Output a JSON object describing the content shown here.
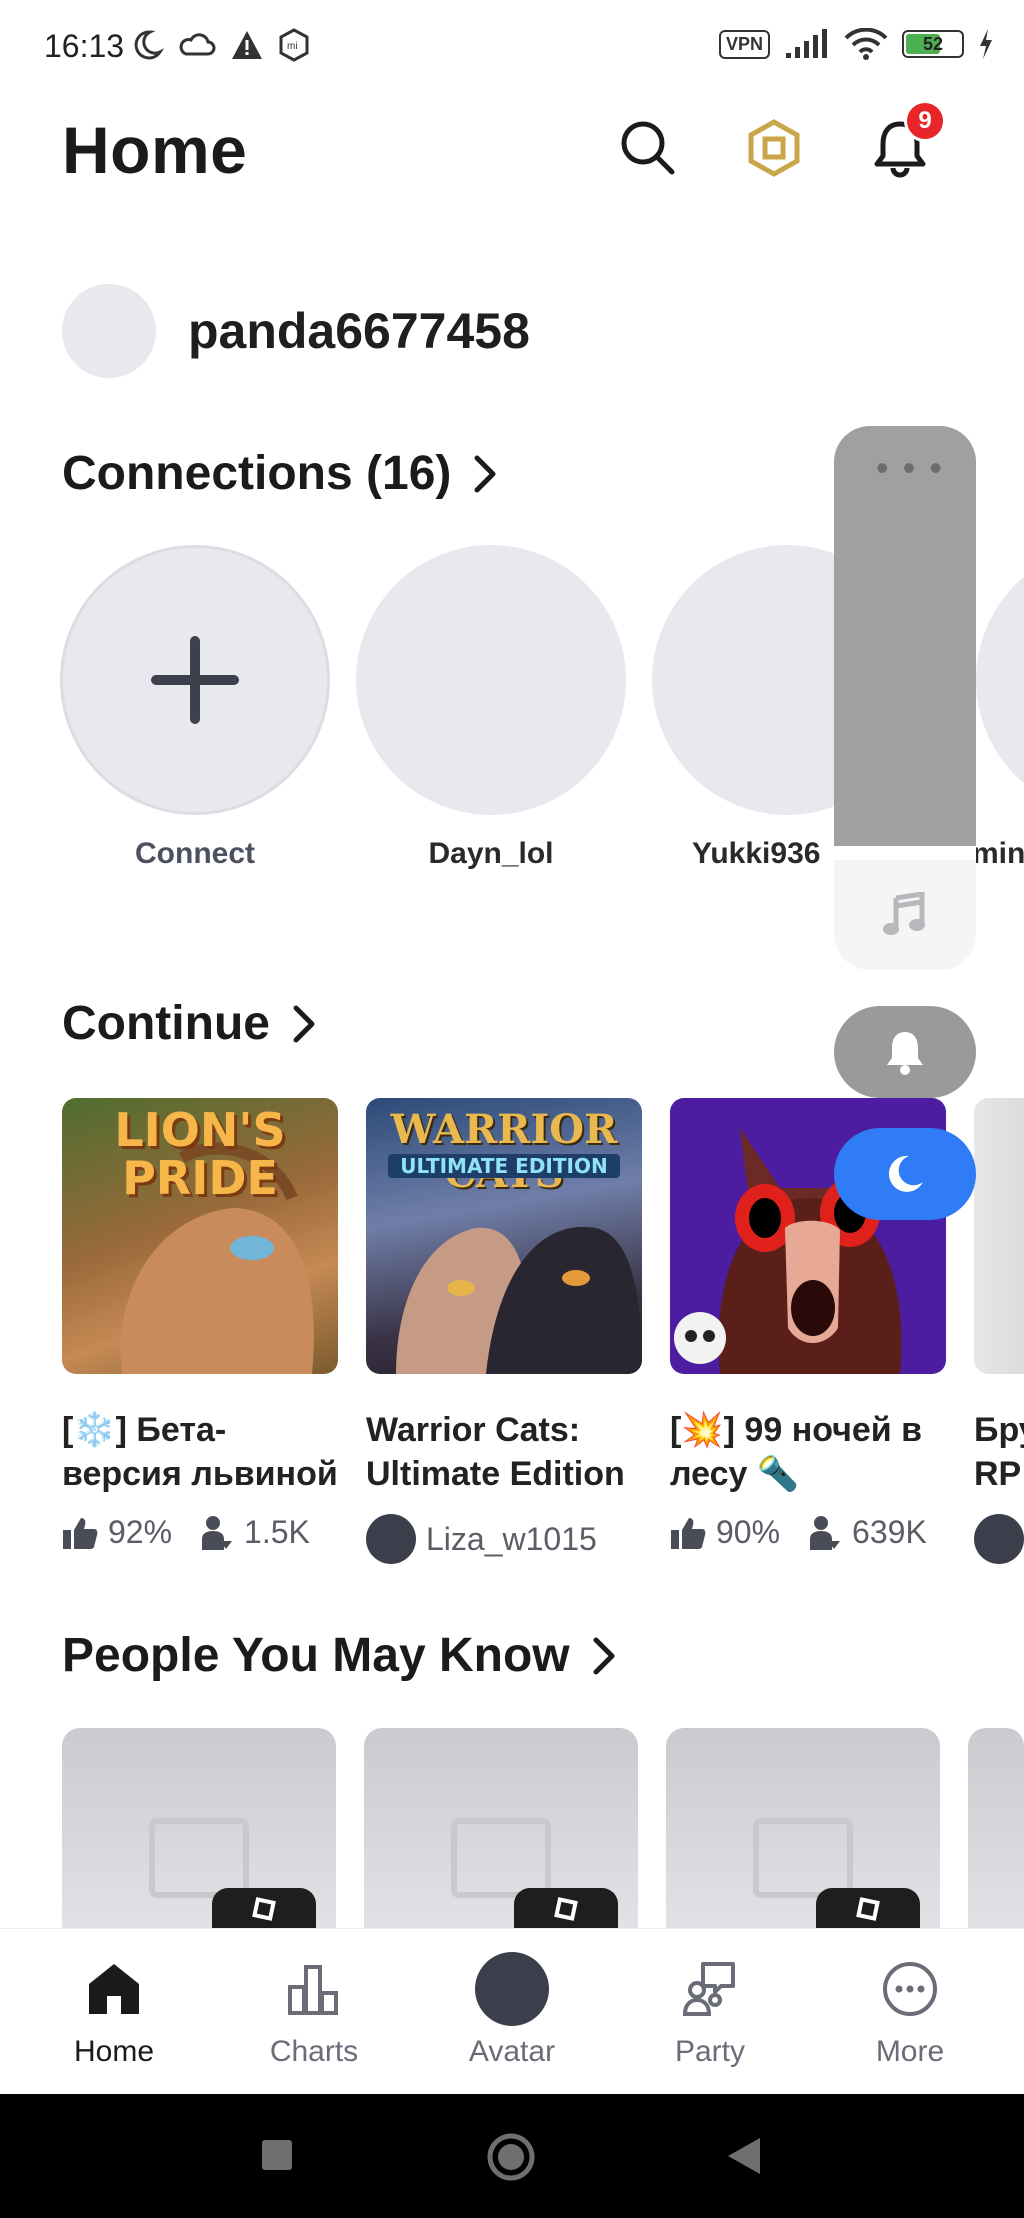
{
  "status_bar": {
    "time": "16:13",
    "vpn": "VPN",
    "battery": "52"
  },
  "header": {
    "title": "Home",
    "notification_count": "9"
  },
  "profile": {
    "username": "panda6677458"
  },
  "connections": {
    "title": "Connections (16)",
    "items": [
      {
        "label": "Connect"
      },
      {
        "label": "Dayn_lol"
      },
      {
        "label": "Yukki936"
      },
      {
        "label": "min"
      }
    ]
  },
  "continue": {
    "title": "Continue",
    "items": [
      {
        "title": "[❄️] Бета-версия львиной гордо...",
        "rating": "92%",
        "players": "1.5K",
        "thumb_text": "LION'S PRIDE"
      },
      {
        "title": "Warrior Cats: Ultimate Edition",
        "creator": "Liza_w1015",
        "thumb_text": "WARRIOR CATS",
        "thumb_sub": "ULTIMATE EDITION"
      },
      {
        "title": "[💥] 99 ночей в лесу 🔦",
        "rating": "90%",
        "players": "639K"
      },
      {
        "title": "Бру RP"
      }
    ]
  },
  "people": {
    "title": "People You May Know"
  },
  "bottom_nav": [
    {
      "label": "Home",
      "icon": "home-icon"
    },
    {
      "label": "Charts",
      "icon": "charts-icon"
    },
    {
      "label": "Avatar",
      "icon": "avatar-icon"
    },
    {
      "label": "Party",
      "icon": "party-icon"
    },
    {
      "label": "More",
      "icon": "more-icon"
    }
  ]
}
